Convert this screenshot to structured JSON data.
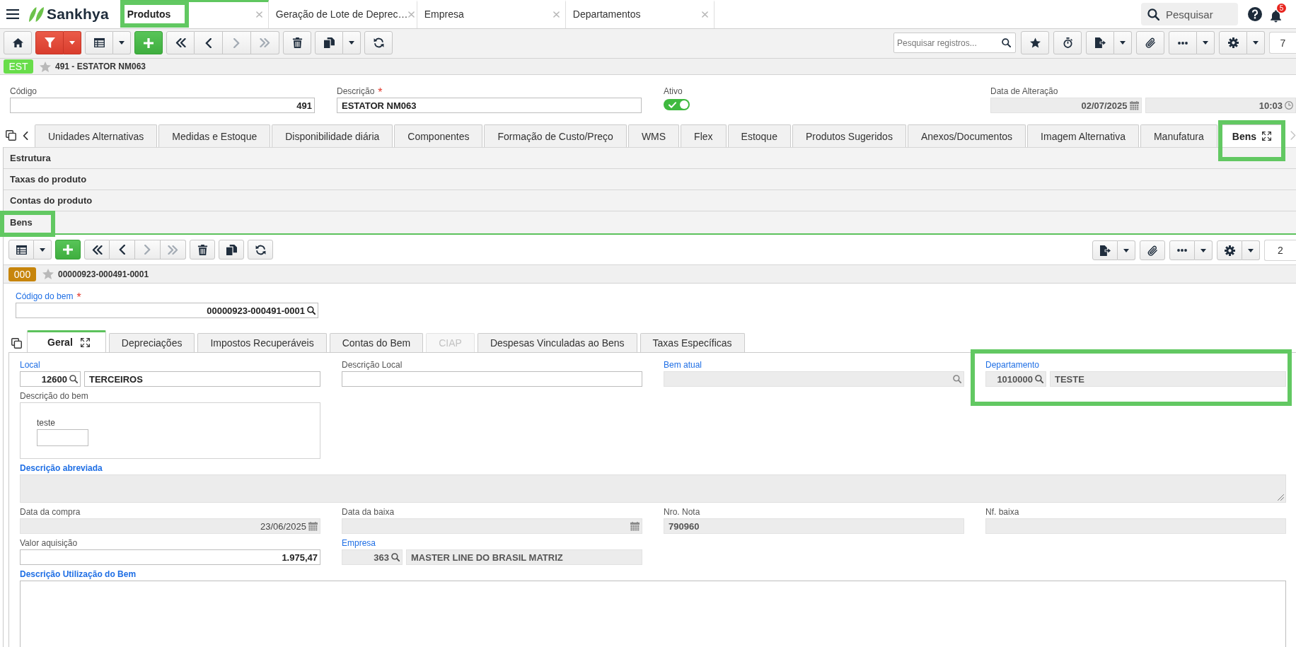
{
  "app_header": {
    "brand": "Sankhya",
    "search_placeholder": "Pesquisar",
    "notification_count": "5"
  },
  "open_tabs": [
    {
      "label": "Produtos",
      "selected": true,
      "highlighted": true
    },
    {
      "label": "Geração de Lote de Deprec…",
      "selected": false,
      "highlighted": false
    },
    {
      "label": "Empresa",
      "selected": false,
      "highlighted": false
    },
    {
      "label": "Departamentos",
      "selected": false,
      "highlighted": false
    }
  ],
  "toolbar": {
    "nav": [
      {
        "kind": "first",
        "disabled": false
      },
      {
        "kind": "previous",
        "disabled": false
      },
      {
        "kind": "next",
        "disabled": true
      },
      {
        "kind": "last",
        "disabled": true
      }
    ],
    "search_placeholder": "Pesquisar registros...",
    "record_count": "7"
  },
  "record": {
    "badge": "EST",
    "title": "491 - ESTATOR NM063"
  },
  "header_fields": [
    {
      "kind": "number",
      "label": "Código",
      "readonly": false,
      "value": "491"
    },
    {
      "kind": "text",
      "label": "Descrição",
      "required_mark": "*",
      "readonly": false,
      "value": "ESTATOR NM063"
    },
    {
      "kind": "toggle",
      "label": "Ativo",
      "on": true
    },
    {
      "kind": "datetime",
      "label": "Data de Alteração",
      "readonly": true,
      "date": "02/07/2025",
      "time": "10:03"
    }
  ],
  "detail_tabs": [
    {
      "label": "Unidades Alternativas",
      "selected": false,
      "highlighted": false
    },
    {
      "label": "Medidas e Estoque",
      "selected": false,
      "highlighted": false
    },
    {
      "label": "Disponibilidade diária",
      "selected": false,
      "highlighted": false
    },
    {
      "label": "Componentes",
      "selected": false,
      "highlighted": false
    },
    {
      "label": "Formação de Custo/Preço",
      "selected": false,
      "highlighted": false
    },
    {
      "label": "WMS",
      "selected": false,
      "highlighted": false
    },
    {
      "label": "Flex",
      "selected": false,
      "highlighted": false
    },
    {
      "label": "Estoque",
      "selected": false,
      "highlighted": false
    },
    {
      "label": "Produtos Sugeridos",
      "selected": false,
      "highlighted": false
    },
    {
      "label": "Anexos/Documentos",
      "selected": false,
      "highlighted": false
    },
    {
      "label": "Imagem Alternativa",
      "selected": false,
      "highlighted": false
    },
    {
      "label": "Manufatura",
      "selected": false,
      "highlighted": false
    },
    {
      "label": "Bens",
      "selected": true,
      "highlighted": true
    }
  ],
  "sections": [
    {
      "label": "Estrutura",
      "expanded": false,
      "highlighted": false
    },
    {
      "label": "Taxas do produto",
      "expanded": false,
      "highlighted": false
    },
    {
      "label": "Contas do produto",
      "expanded": false,
      "highlighted": false
    },
    {
      "label": "Bens",
      "expanded": true,
      "highlighted": true
    }
  ],
  "sub_toolbar": {
    "nav": [
      {
        "kind": "first",
        "disabled": false
      },
      {
        "kind": "previous",
        "disabled": false
      },
      {
        "kind": "next",
        "disabled": true
      },
      {
        "kind": "last",
        "disabled": true
      }
    ],
    "record_count": "2"
  },
  "sub_record": {
    "badge": "000",
    "title": "00000923-000491-0001"
  },
  "key_field": {
    "label": "Código do bem",
    "required_mark": "*",
    "value": "00000923-000491-0001"
  },
  "asset_tabs": [
    {
      "label": "Geral",
      "selected": true,
      "disabled": false
    },
    {
      "label": "Depreciações",
      "selected": false,
      "disabled": false
    },
    {
      "label": "Impostos Recuperáveis",
      "selected": false,
      "disabled": false
    },
    {
      "label": "Contas do Bem",
      "selected": false,
      "disabled": false
    },
    {
      "label": "CIAP",
      "selected": false,
      "disabled": true
    },
    {
      "label": "Despesas Vinculadas ao Bens",
      "selected": false,
      "disabled": false
    },
    {
      "label": "Taxas Específicas",
      "selected": false,
      "disabled": false
    }
  ],
  "asset_form": [
    {
      "kind": "lookup",
      "label": "Local",
      "linked": true,
      "readonly": false,
      "highlighted": false,
      "code": "12600",
      "description": "TERCEIROS"
    },
    {
      "kind": "text",
      "label": "Descrição Local",
      "linked": false,
      "readonly": false,
      "highlighted": false
    },
    {
      "kind": "search",
      "label": "Bem atual",
      "linked": true,
      "readonly": true,
      "highlighted": false
    },
    {
      "kind": "lookup",
      "label": "Departamento",
      "linked": true,
      "readonly": true,
      "highlighted": true,
      "code": "1010000",
      "description": "TESTE"
    },
    {
      "kind": "richtext",
      "label": "Descrição do bem",
      "linked": false,
      "readonly": false,
      "highlighted": false,
      "content": "teste"
    },
    {
      "kind": "textarea",
      "label": "Descrição abreviada",
      "linked": true,
      "readonly": true,
      "highlighted": false,
      "resizable": true
    },
    {
      "kind": "date",
      "label": "Data da compra",
      "linked": false,
      "readonly": true,
      "highlighted": false,
      "value": "23/06/2025"
    },
    {
      "kind": "date",
      "label": "Data da baixa",
      "linked": false,
      "readonly": true,
      "highlighted": false
    },
    {
      "kind": "text",
      "label": "Nro. Nota",
      "linked": false,
      "readonly": true,
      "highlighted": false,
      "value": "790960"
    },
    {
      "kind": "text",
      "label": "Nf. baixa",
      "linked": false,
      "readonly": true,
      "highlighted": false
    },
    {
      "kind": "number",
      "label": "Valor aquisição",
      "linked": false,
      "readonly": false,
      "highlighted": false,
      "value": "1.975,47"
    },
    {
      "kind": "lookup",
      "label": "Empresa",
      "linked": true,
      "readonly": true,
      "highlighted": false,
      "code": "363",
      "description": "MASTER LINE DO BRASIL MATRIZ"
    },
    {
      "kind": "textarea",
      "label": "Descrição Utilização do Bem",
      "linked": true,
      "readonly": false,
      "highlighted": false,
      "resizable": false
    }
  ]
}
